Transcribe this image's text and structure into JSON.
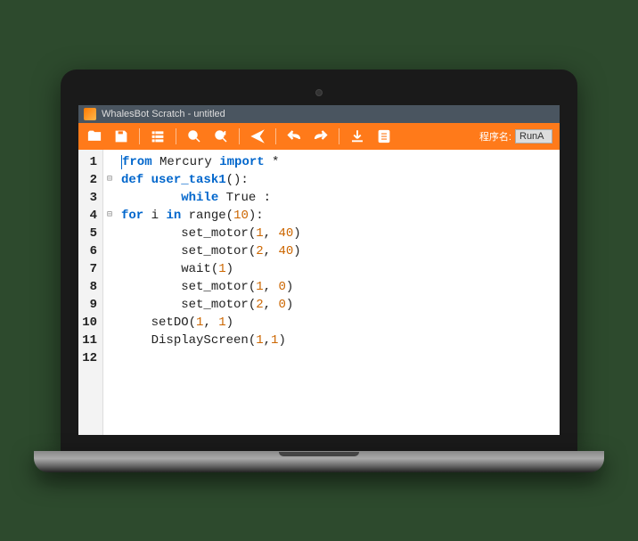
{
  "titlebar": {
    "title": "WhalesBot Scratch - untitled"
  },
  "toolbar": {
    "program_label": "程序名:",
    "program_name": "RunA"
  },
  "code": {
    "lines": [
      {
        "n": 1,
        "fold": "",
        "indent": 0,
        "segments": [
          [
            "kw",
            "from"
          ],
          [
            "txt",
            " Mercury "
          ],
          [
            "kw",
            "import"
          ],
          [
            "txt",
            " *"
          ]
        ]
      },
      {
        "n": 2,
        "fold": "⊟",
        "indent": 0,
        "segments": [
          [
            "kw",
            "def "
          ],
          [
            "fn",
            "user_task1"
          ],
          [
            "txt",
            "():"
          ]
        ]
      },
      {
        "n": 3,
        "fold": "",
        "indent": 2,
        "segments": [
          [
            "kw",
            "while"
          ],
          [
            "txt",
            " True :"
          ]
        ]
      },
      {
        "n": 4,
        "fold": "⊟",
        "indent": 0,
        "segments": [
          [
            "kw",
            "for"
          ],
          [
            "txt",
            " i "
          ],
          [
            "kw",
            "in"
          ],
          [
            "txt",
            " range("
          ],
          [
            "num",
            "10"
          ],
          [
            "txt",
            "):"
          ]
        ]
      },
      {
        "n": 5,
        "fold": "",
        "indent": 2,
        "segments": [
          [
            "txt",
            "set_motor("
          ],
          [
            "num",
            "1"
          ],
          [
            "txt",
            ", "
          ],
          [
            "num",
            "40"
          ],
          [
            "txt",
            ")"
          ]
        ]
      },
      {
        "n": 6,
        "fold": "",
        "indent": 2,
        "segments": [
          [
            "txt",
            "set_motor("
          ],
          [
            "num",
            "2"
          ],
          [
            "txt",
            ", "
          ],
          [
            "num",
            "40"
          ],
          [
            "txt",
            ")"
          ]
        ]
      },
      {
        "n": 7,
        "fold": "",
        "indent": 2,
        "segments": [
          [
            "txt",
            "wait("
          ],
          [
            "num",
            "1"
          ],
          [
            "txt",
            ")"
          ]
        ]
      },
      {
        "n": 8,
        "fold": "",
        "indent": 2,
        "segments": [
          [
            "txt",
            "set_motor("
          ],
          [
            "num",
            "1"
          ],
          [
            "txt",
            ", "
          ],
          [
            "num",
            "0"
          ],
          [
            "txt",
            ")"
          ]
        ]
      },
      {
        "n": 9,
        "fold": "",
        "indent": 2,
        "segments": [
          [
            "txt",
            "set_motor("
          ],
          [
            "num",
            "2"
          ],
          [
            "txt",
            ", "
          ],
          [
            "num",
            "0"
          ],
          [
            "txt",
            ")"
          ]
        ]
      },
      {
        "n": 10,
        "fold": "",
        "indent": 1,
        "segments": [
          [
            "txt",
            "setDO("
          ],
          [
            "num",
            "1"
          ],
          [
            "txt",
            ", "
          ],
          [
            "num",
            "1"
          ],
          [
            "txt",
            ")"
          ]
        ]
      },
      {
        "n": 11,
        "fold": "",
        "indent": 1,
        "segments": [
          [
            "txt",
            "DisplayScreen("
          ],
          [
            "num",
            "1"
          ],
          [
            "txt",
            ","
          ],
          [
            "num",
            "1"
          ],
          [
            "txt",
            ")"
          ]
        ]
      },
      {
        "n": 12,
        "fold": "",
        "indent": 0,
        "segments": []
      }
    ]
  }
}
